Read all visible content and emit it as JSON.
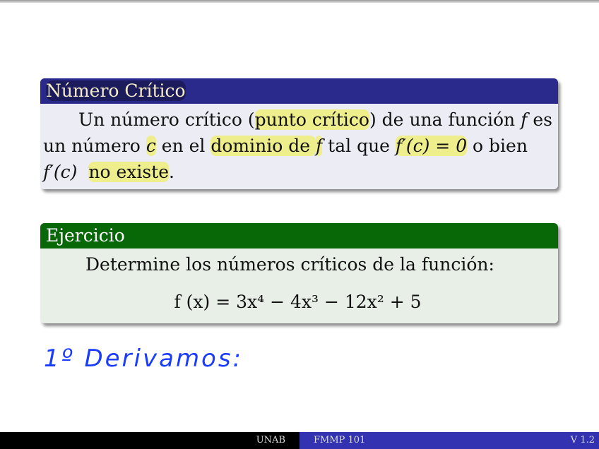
{
  "definition": {
    "title": "Número Crítico",
    "t1": "Un número crítico (",
    "t2": "punto crítico",
    "t3": ") de una función ",
    "f": "f",
    "t4": " es un número ",
    "c": "c",
    "t5": " en el ",
    "t6": "dominio de ",
    "t7": " tal que ",
    "fpc": "f′(c) = 0",
    "t8": " o bien ",
    "fpc2": "f′(c)",
    "t9": "no existe",
    "t10": "."
  },
  "exercise": {
    "title": "Ejercicio",
    "text": "Determine los números críticos de la función:",
    "formula": "f (x) = 3x⁴ − 4x³ − 12x² + 5"
  },
  "handwriting": "1º Derivamos:",
  "footer": {
    "left": "UNAB",
    "center": "FMMP 101",
    "right": "V 1.2"
  }
}
